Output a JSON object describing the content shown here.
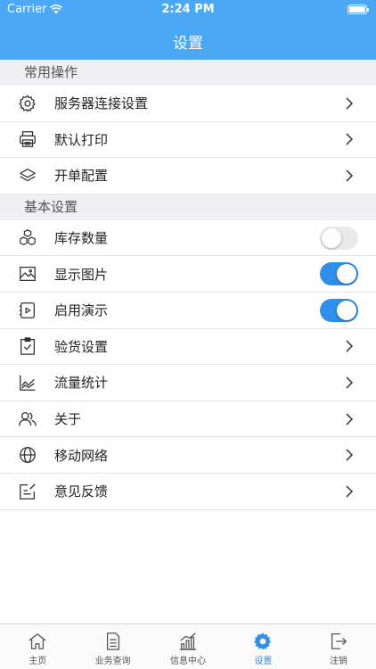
{
  "status_bar": {
    "carrier": "Carrier",
    "time": "2:24 PM"
  },
  "nav": {
    "title": "设置"
  },
  "sections": [
    {
      "header": "常用操作",
      "rows": [
        {
          "label": "服务器连接设置",
          "icon": "gear-icon"
        },
        {
          "label": "默认打印",
          "icon": "printer-icon"
        },
        {
          "label": "开单配置",
          "icon": "layers-icon"
        }
      ]
    },
    {
      "header": "基本设置",
      "rows": [
        {
          "label": "库存数量",
          "icon": "boxes-icon",
          "toggle": false
        },
        {
          "label": "显示图片",
          "icon": "image-icon",
          "toggle": true
        },
        {
          "label": "启用演示",
          "icon": "play-icon",
          "toggle": true
        },
        {
          "label": "验货设置",
          "icon": "clipboard-check-icon"
        },
        {
          "label": "流量统计",
          "icon": "line-chart-icon"
        },
        {
          "label": "关于",
          "icon": "users-icon"
        },
        {
          "label": "移动网络",
          "icon": "globe-icon"
        },
        {
          "label": "意见反馈",
          "icon": "feedback-icon"
        }
      ]
    }
  ],
  "tabs": [
    {
      "label": "主页",
      "icon": "home-icon",
      "active": false
    },
    {
      "label": "业务查询",
      "icon": "document-icon",
      "active": false
    },
    {
      "label": "信息中心",
      "icon": "bar-chart-icon",
      "active": false
    },
    {
      "label": "设置",
      "icon": "gear-icon",
      "active": true
    },
    {
      "label": "注销",
      "icon": "logout-icon",
      "active": false
    }
  ],
  "colors": {
    "header": "#4aa8f7",
    "accent": "#2f8ee8",
    "section_bg": "#eeeef3"
  }
}
